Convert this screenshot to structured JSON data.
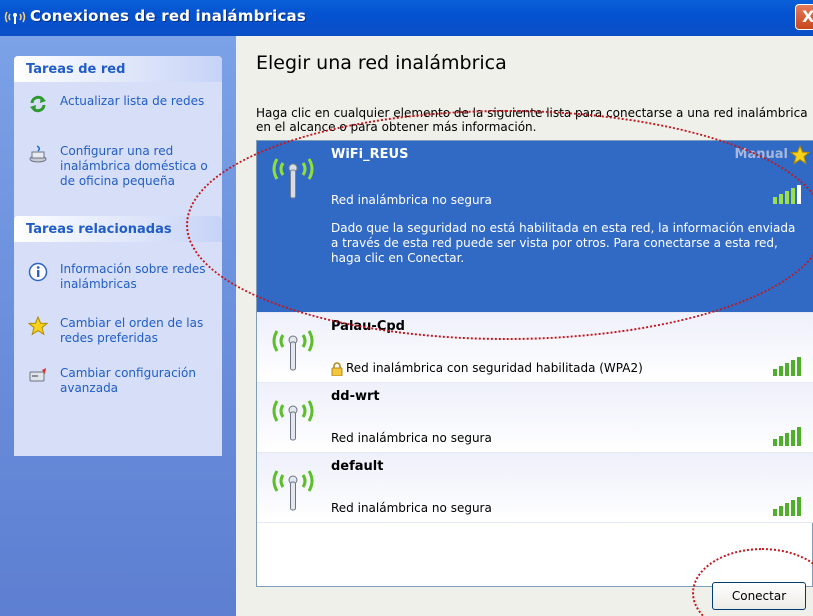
{
  "window": {
    "title": "Conexiones de red inalámbricas",
    "close_label": "X"
  },
  "sidebar": {
    "network_tasks": {
      "title": "Tareas de red",
      "items": [
        {
          "label": "Actualizar lista de redes",
          "icon": "refresh-icon"
        },
        {
          "label": "Configurar una red inalámbrica doméstica o de oficina pequeña",
          "icon": "wizard-icon"
        }
      ]
    },
    "related_tasks": {
      "title": "Tareas relacionadas",
      "items": [
        {
          "label": "Información sobre redes inalámbricas",
          "icon": "info-icon"
        },
        {
          "label": "Cambiar el orden de las redes preferidas",
          "icon": "star-icon"
        },
        {
          "label": "Cambiar configuración avanzada",
          "icon": "settings-icon"
        }
      ]
    }
  },
  "main": {
    "heading": "Elegir una red inalámbrica",
    "description": "Haga clic en cualquier elemento de la siguiente lista para conectarse a una red inalámbrica en el alcance o para obtener más información.",
    "networks": [
      {
        "ssid": "WiFi_REUS",
        "security": "Red inalámbrica no segura",
        "badge": "Manual",
        "warning": "Dado que la seguridad no está habilitada en esta red, la información enviada a través de esta red puede ser vista por otros. Para conectarse a esta red, haga clic en Conectar.",
        "selected": true,
        "signal_bars": 5
      },
      {
        "ssid": "Palau-Cpd",
        "security": "Red inalámbrica con seguridad habilitada (WPA2)",
        "selected": false,
        "signal_bars": 5
      },
      {
        "ssid": "dd-wrt",
        "security": "Red inalámbrica no segura",
        "selected": false,
        "signal_bars": 5
      },
      {
        "ssid": "default",
        "security": "Red inalámbrica no segura",
        "selected": false,
        "signal_bars": 5
      }
    ],
    "connect_label": "Conectar"
  },
  "colors": {
    "titlebar": "#0452d0",
    "sidebar": "#6a8fdc",
    "selected_row": "#316ac5",
    "link": "#215dc6",
    "annotation": "#c4161c"
  }
}
